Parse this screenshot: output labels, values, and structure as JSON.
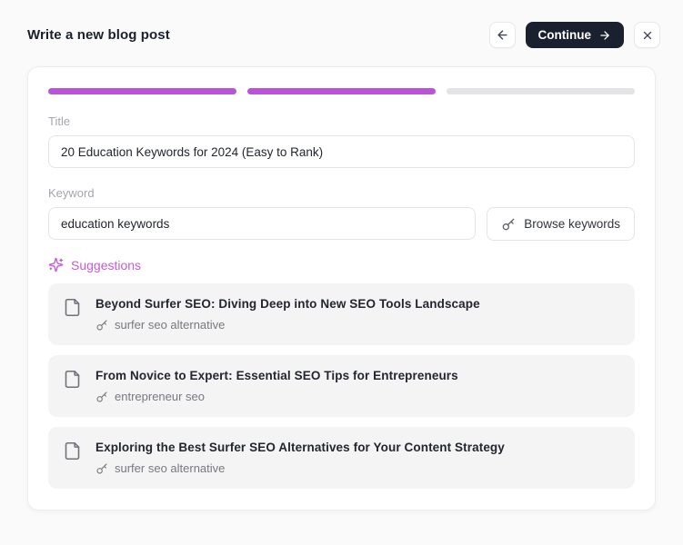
{
  "header": {
    "title": "Write a new blog post",
    "continue_label": "Continue"
  },
  "colors": {
    "accent_purple": "#b954d8",
    "suggestion_accent": "#c65bd6",
    "progress_inactive": "#e4e4e7",
    "dark_button_bg": "#1b202e",
    "card_bg": "#f4f4f5"
  },
  "progress": {
    "total_steps": 3,
    "completed_steps": 2
  },
  "form": {
    "title_label": "Title",
    "title_value": "20 Education Keywords for 2024 (Easy to Rank)",
    "keyword_label": "Keyword",
    "keyword_value": "education keywords",
    "browse_button_label": "Browse keywords"
  },
  "suggestions": {
    "heading": "Suggestions",
    "items": [
      {
        "title": "Beyond Surfer SEO: Diving Deep into New SEO Tools Landscape",
        "keyword": "surfer seo alternative"
      },
      {
        "title": "From Novice to Expert: Essential SEO Tips for Entrepreneurs",
        "keyword": "entrepreneur seo"
      },
      {
        "title": "Exploring the Best Surfer SEO Alternatives for Your Content Strategy",
        "keyword": "surfer seo alternative"
      }
    ]
  }
}
